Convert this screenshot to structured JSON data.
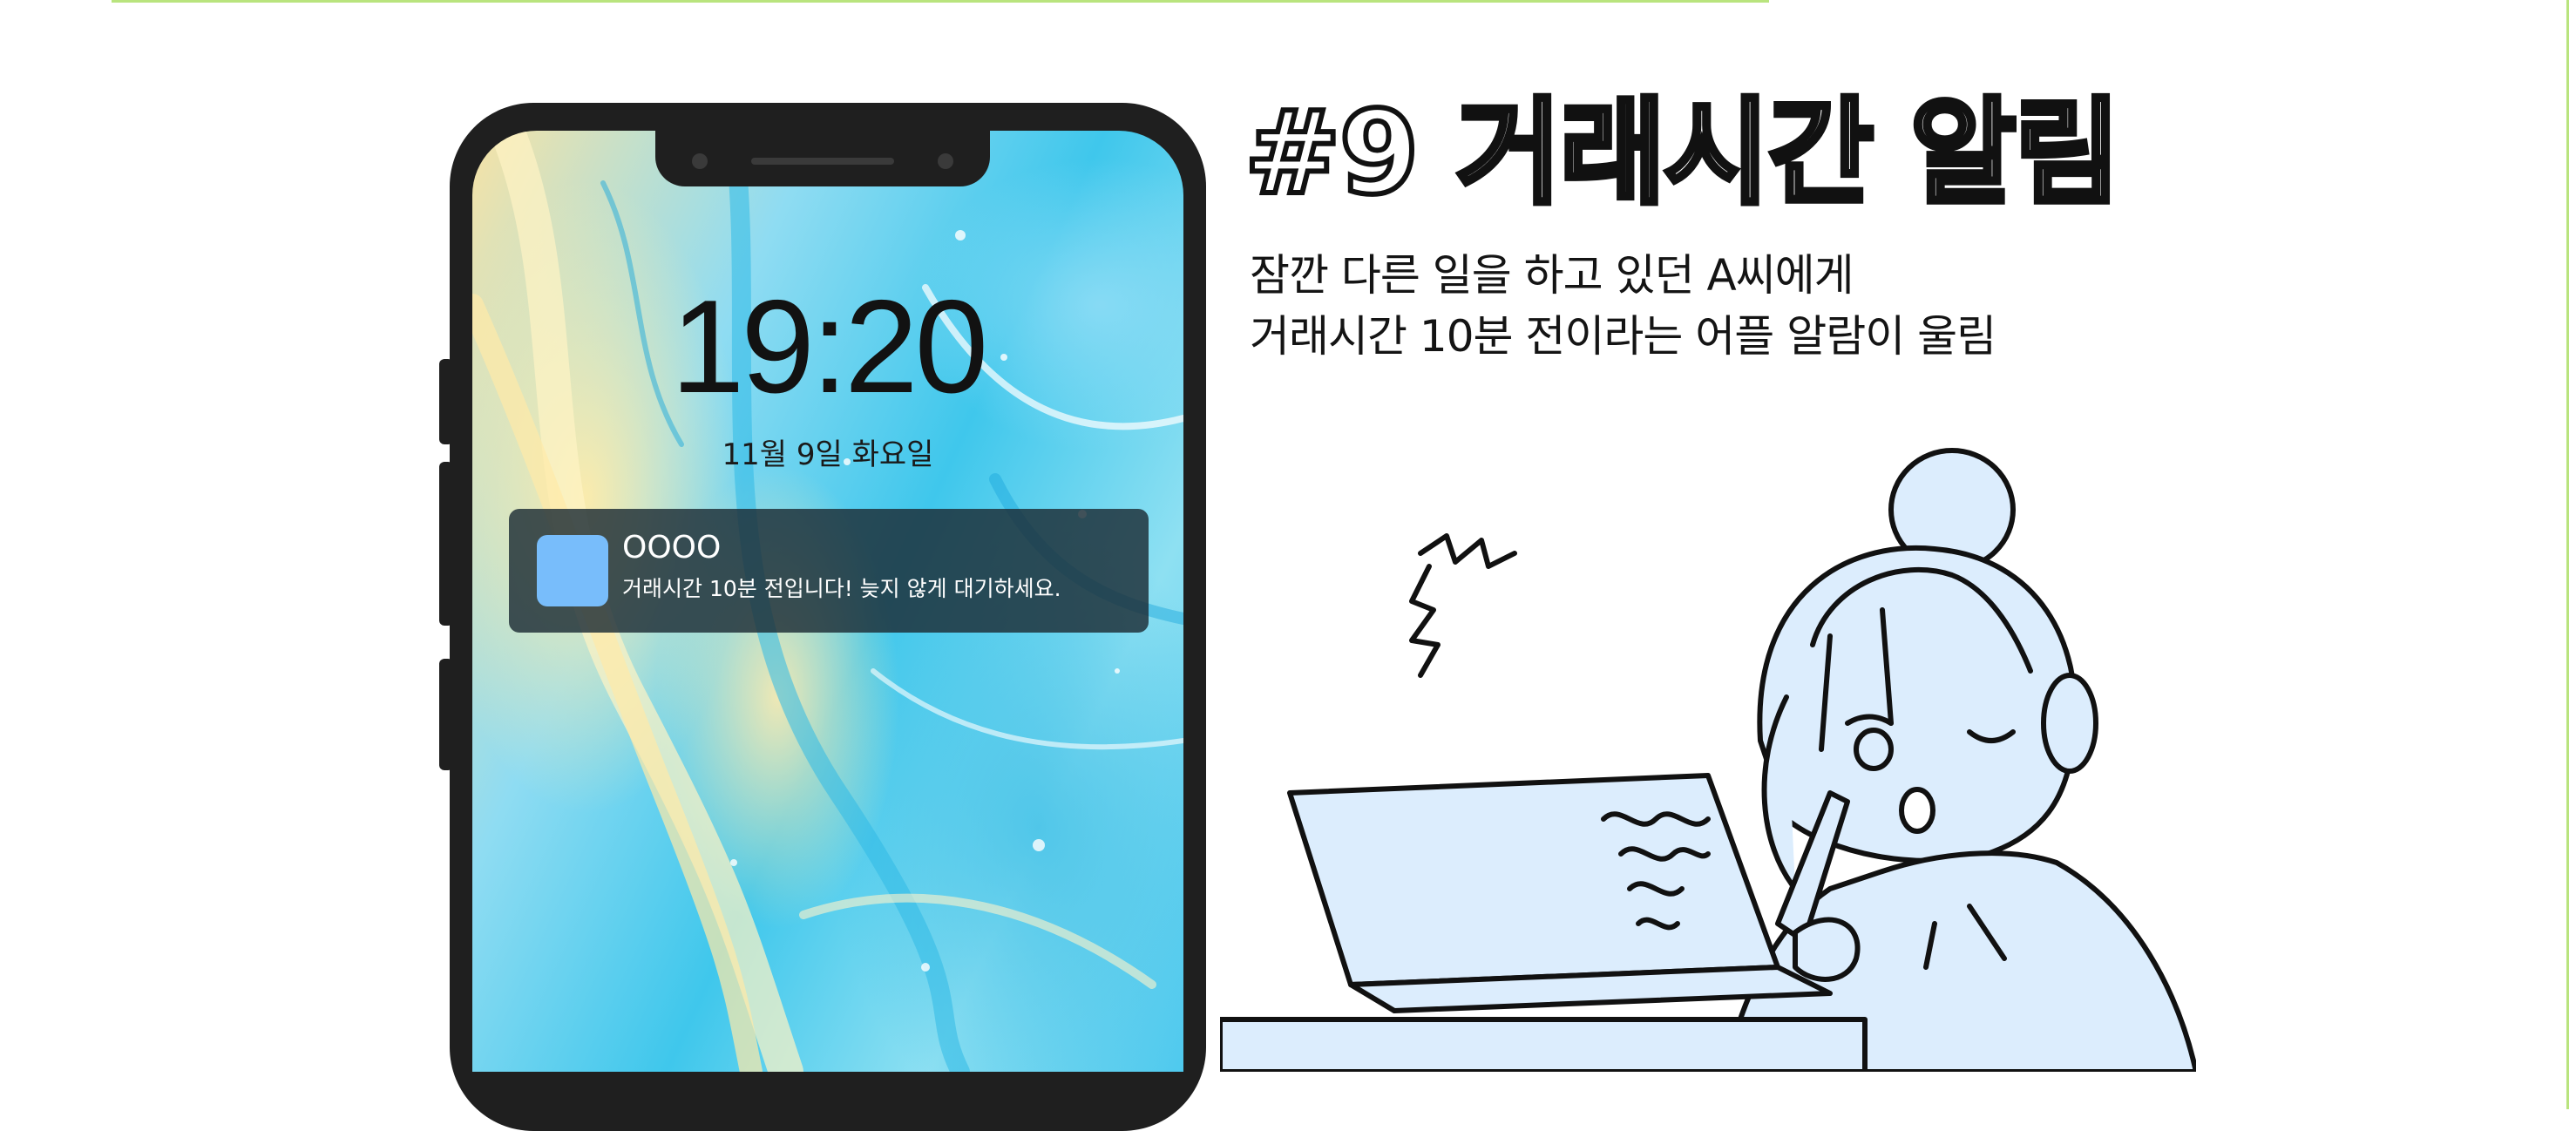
{
  "lockscreen": {
    "time": "19:20",
    "date": "11월 9일 화요일",
    "notification": {
      "app_name": "OOOO",
      "message": "거래시간 10분 전입니다! 늦지 않게 대기하세요.",
      "icon_color": "#78bdfb"
    }
  },
  "panel": {
    "title": "#9 거래시간 알림",
    "subtitle_line1": "잠깐 다른 일을 하고 있던 A씨에게",
    "subtitle_line2": "거래시간 10분 전이라는 어플 알람이 울림"
  },
  "colors": {
    "frame_accent": "#b9e47e",
    "phone_body": "#1f1f1f",
    "illustration_fill": "#dcedfd"
  }
}
